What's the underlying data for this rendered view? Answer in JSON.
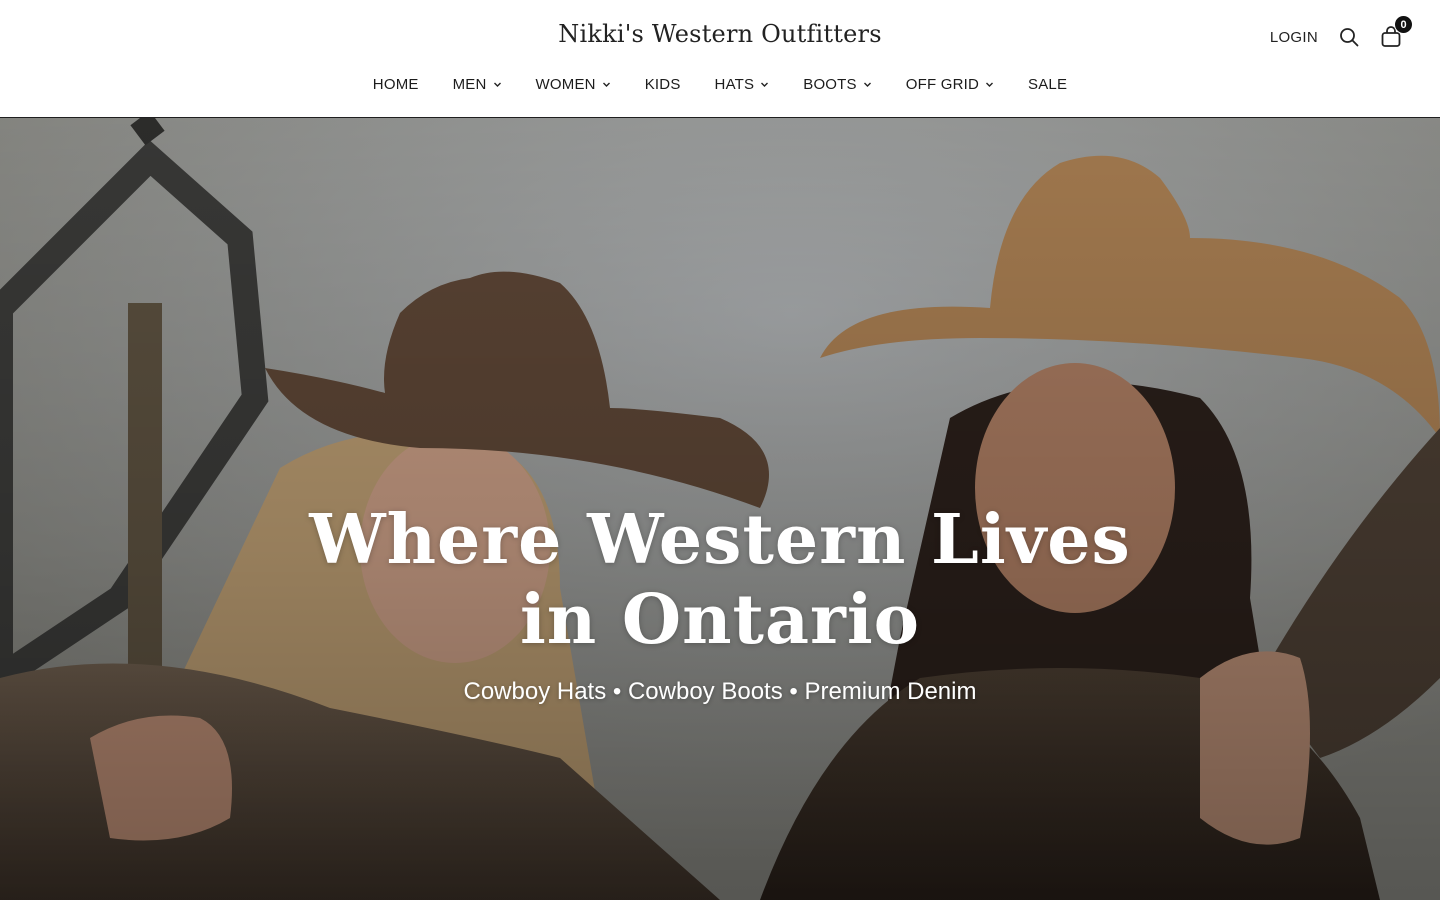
{
  "header": {
    "brand": "Nikki's Western Outfitters",
    "login_label": "LOGIN",
    "search_icon": "search-icon",
    "cart_icon": "shopping-bag-icon",
    "cart_count": "0"
  },
  "nav": {
    "items": [
      {
        "label": "HOME",
        "has_dropdown": false
      },
      {
        "label": "MEN",
        "has_dropdown": true
      },
      {
        "label": "WOMEN",
        "has_dropdown": true
      },
      {
        "label": "KIDS",
        "has_dropdown": false
      },
      {
        "label": "HATS",
        "has_dropdown": true
      },
      {
        "label": "BOOTS",
        "has_dropdown": true
      },
      {
        "label": "OFF GRID",
        "has_dropdown": true
      },
      {
        "label": "SALE",
        "has_dropdown": false
      }
    ]
  },
  "hero": {
    "title": "Where Western Lives in Ontario",
    "subtitle": "Cowboy Hats • Cowboy Boots • Premium Denim"
  },
  "colors": {
    "header_bg": "#ffffff",
    "text": "#1a1a1a",
    "hero_text": "#ffffff",
    "badge": "#111111"
  }
}
